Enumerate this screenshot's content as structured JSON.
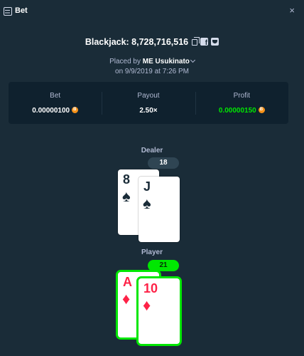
{
  "window": {
    "title": "Bet",
    "close_glyph": "×"
  },
  "header": {
    "title": "Blackjack: 8,728,716,516"
  },
  "placed_by": {
    "prefix": "Placed by",
    "user": "ME Usukinato",
    "date": "on 9/9/2019 at 7:26 PM"
  },
  "stats": {
    "bet": {
      "label": "Bet",
      "value": "0.00000100"
    },
    "payout": {
      "label": "Payout",
      "value": "2.50×"
    },
    "profit": {
      "label": "Profit",
      "value": "0.00000150"
    }
  },
  "dealer": {
    "label": "Dealer",
    "score": "18",
    "cards": [
      {
        "rank": "8",
        "suit": "♠"
      },
      {
        "rank": "J",
        "suit": "♠"
      }
    ]
  },
  "player": {
    "label": "Player",
    "score": "21",
    "cards": [
      {
        "rank": "A",
        "suit": "♦"
      },
      {
        "rank": "10",
        "suit": "♦"
      }
    ]
  },
  "colors": {
    "background": "#1a2c38",
    "panel": "#0f212e",
    "win": "#00e701",
    "red_suit": "#fe2247",
    "coin": "#f7931a"
  },
  "icons": [
    "bet-list-icon",
    "close-icon",
    "copy-icon",
    "facebook-icon",
    "twitter-icon",
    "bitcoin-icon",
    "chevron-down-icon"
  ]
}
